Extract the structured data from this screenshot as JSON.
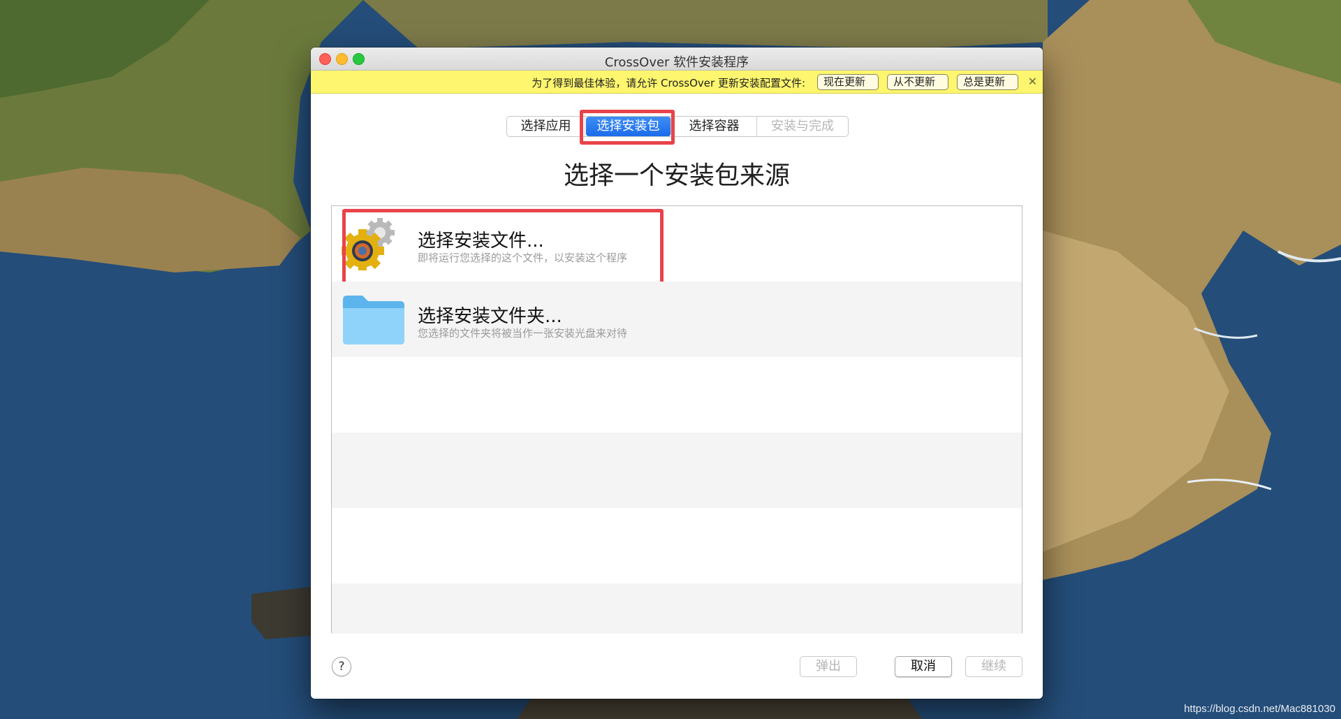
{
  "window": {
    "title": "CrossOver 软件安装程序"
  },
  "notice": {
    "message": "为了得到最佳体验，请允许 CrossOver 更新安装配置文件:",
    "update_now": "现在更新",
    "never_update": "从不更新",
    "always_update": "总是更新",
    "close_symbol": "✕"
  },
  "steps": [
    {
      "label": "选择应用",
      "state": "normal"
    },
    {
      "label": "选择安装包",
      "state": "selected"
    },
    {
      "label": "选择容器",
      "state": "normal"
    },
    {
      "label": "安装与完成",
      "state": "disabled"
    }
  ],
  "heading": "选择一个安装包来源",
  "options": [
    {
      "title": "选择安装文件...",
      "subtitle": "即将运行您选择的这个文件，以安装这个程序",
      "icon": "installer-gear-icon"
    },
    {
      "title": "选择安装文件夹...",
      "subtitle": "您选择的文件夹将被当作一张安装光盘来对待",
      "icon": "folder-icon"
    }
  ],
  "footer": {
    "help": "?",
    "eject": "弹出",
    "cancel": "取消",
    "continue": "继续"
  },
  "watermark": "https://blog.csdn.net/Mac881030",
  "colors": {
    "notice_bg": "#fdf66e",
    "selected_step": "#1c6bea",
    "highlight": "#e8434a"
  }
}
